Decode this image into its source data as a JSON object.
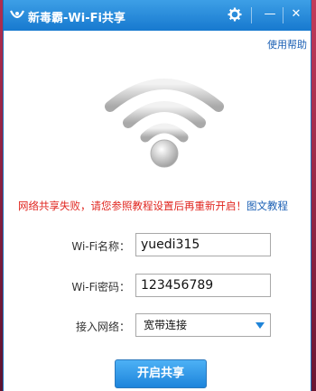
{
  "window": {
    "title": "新毒霸-Wi-Fi共享",
    "settings_icon": "gear-icon",
    "minimize_label": "—",
    "close_label": "✕"
  },
  "help_link": "使用帮助",
  "message": {
    "error": "网络共享失败，请您参照教程设置后再重新开启！",
    "link": "图文教程"
  },
  "form": {
    "wifi_name_label": "Wi-Fi名称：",
    "wifi_name_value": "yuedi315",
    "wifi_password_label": "Wi-Fi密码：",
    "wifi_password_value": "123456789",
    "network_label": "接入网络：",
    "network_selected": "宽带连接"
  },
  "start_button": "开启共享",
  "colors": {
    "title_bar": "#1779cf",
    "error_text": "#e0261f",
    "link_text": "#1a5fb4",
    "button": "#1d84db"
  }
}
